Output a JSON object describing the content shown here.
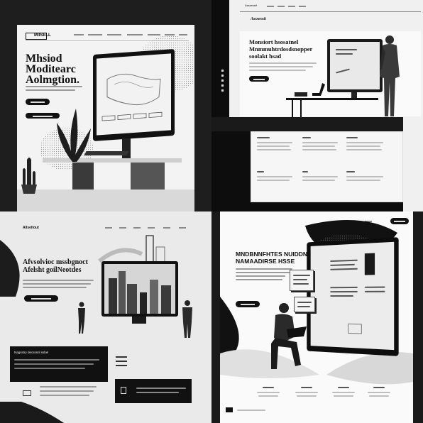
{
  "q1": {
    "logo": "MIISELL",
    "headline": [
      "Mhsiod",
      "Moditearc",
      "Aolmgtion."
    ]
  },
  "q2": {
    "logo": "Asssesstt",
    "headline": [
      "Monsiort hsosatnel",
      "Mnmmuhtrdosdsnopper",
      "soolakt hsad"
    ]
  },
  "q3": {
    "logo": "Allseltout",
    "headline": [
      "Afvsolvioc mssbgnoct",
      "Afelsht goilNeotdes"
    ],
    "card_title": "Nagsstry decsssnl ssbel"
  },
  "q4": {
    "headline": [
      "MNDBNNFHTES NUIDDNO",
      "NAMAADIRSE HSSE"
    ]
  },
  "colors": {
    "dark": "#111111",
    "light": "#f3f3f3",
    "mid": "#9a9a9a"
  }
}
